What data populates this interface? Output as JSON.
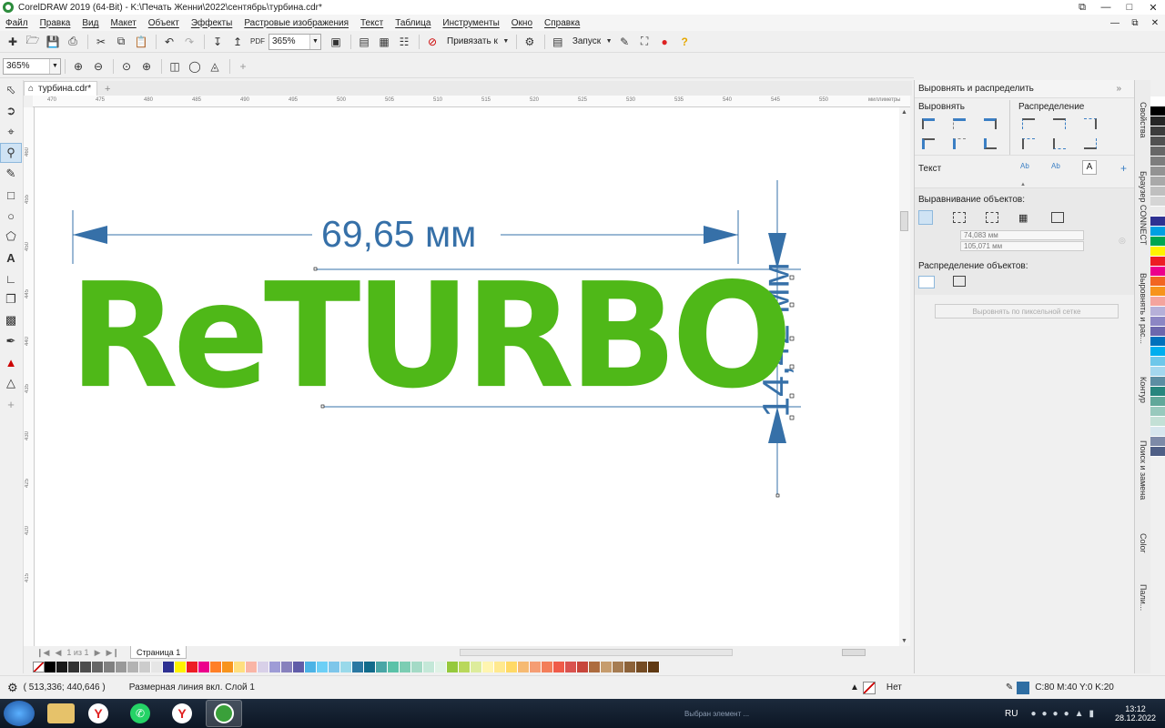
{
  "window": {
    "title": "CorelDRAW 2019 (64-Bit) - K:\\Печать Женни\\2022\\сентябрь\\турбина.cdr*",
    "buttons": [
      "⧉",
      "—",
      "□",
      "✕"
    ]
  },
  "menu": [
    "Файл",
    "Правка",
    "Вид",
    "Макет",
    "Объект",
    "Эффекты",
    "Растровые изображения",
    "Текст",
    "Таблица",
    "Инструменты",
    "Окно",
    "Справка"
  ],
  "toolbar": {
    "zoom_value": "365%",
    "snap_label": "Привязать к",
    "launch_label": "Запуск"
  },
  "propbar": {
    "zoom_value": "365%"
  },
  "document": {
    "tab_label": "турбина.cdr*",
    "ruler_unit": "миллиметры",
    "h_ruler_labels": [
      "470",
      "475",
      "480",
      "485",
      "490",
      "495",
      "500",
      "505",
      "510",
      "515",
      "520",
      "525",
      "530",
      "535",
      "540",
      "545",
      "550"
    ],
    "v_ruler_labels": [
      "460",
      "455",
      "450",
      "445",
      "440",
      "435",
      "430",
      "425",
      "420",
      "415"
    ],
    "page_tab": "Страница 1",
    "page_counter": "1  из  1"
  },
  "artwork": {
    "main_text": "ReTURBO",
    "width_dimension": "69,65 мм",
    "height_dimension": "14,42 мм",
    "text_color": "#4fb818",
    "dim_color": "#3670a8"
  },
  "docker": {
    "title": "Выровнять и распределить",
    "align_label": "Выровнять",
    "distribute_label": "Распределение",
    "text_label": "Текст",
    "align_objects_label": "Выравнивание объектов:",
    "x_value": "74,083 мм",
    "y_value": "105,071 мм",
    "distribute_objects_label": "Распределение объектов:",
    "pixel_grid_button": "Выровнять по пиксельной сетке"
  },
  "side_tabs": [
    "Свойства",
    "Браузер CONNECT",
    "Выровнять и рас...",
    "Контур",
    "Поиск и замена",
    "Color",
    "Пали..."
  ],
  "status": {
    "coordinates": "( 513,336; 440,646 )",
    "selection_info": "Размерная линия вкл. Слой 1",
    "fill_label": "Нет",
    "outline_color": "C:80 M:40 Y:0 K:20"
  },
  "taskbar": {
    "language": "RU",
    "time": "13:12",
    "date": "28.12.2022",
    "notification_text": "Выбран элемент ..."
  },
  "palette_colors": [
    "#000000",
    "#1a1a1a",
    "#333333",
    "#4d4d4d",
    "#666666",
    "#808080",
    "#999999",
    "#b3b3b3",
    "#cccccc",
    "#e6e6e6",
    "#2e3192",
    "#fff200",
    "#ed1c24",
    "#ec008c",
    "#ff7f27",
    "#f7941d",
    "#ffdf7f",
    "#f9b5a6",
    "#d8d0e8",
    "#9e9cd6",
    "#8781bd",
    "#605ca8",
    "#4cb3e6",
    "#6dcff6",
    "#7ec6ea",
    "#99d9ea",
    "#2b78a2",
    "#126b8b",
    "#49a6a6",
    "#5bc2a8",
    "#7ccdb3",
    "#a4dac6",
    "#c4e8d8",
    "#e0f2e6",
    "#95c93d",
    "#b9d85c",
    "#ddec9c",
    "#fff5b0",
    "#ffe98f",
    "#ffd966",
    "#f6ba73",
    "#f59d74",
    "#f37e5a",
    "#ef5b49",
    "#d9534f",
    "#c7463b",
    "#ad6c3f",
    "#c69c6d",
    "#a67c52",
    "#8c6239",
    "#754c24",
    "#603913"
  ],
  "palette_v_colors": [
    "#ffffff",
    "#000000",
    "#262626",
    "#3c3c3c",
    "#515151",
    "#676767",
    "#7d7d7d",
    "#939393",
    "#a9a9a9",
    "#bfbfbf",
    "#d5d5d5",
    "#ebebeb",
    "#2e3192",
    "#00a0e3",
    "#00a651",
    "#fff200",
    "#ed1c24",
    "#ec008c",
    "#f26522",
    "#f7941d",
    "#f4a49e",
    "#b6b0d9",
    "#8c86c4",
    "#6c67ad",
    "#0071bc",
    "#00aeef",
    "#6ec7ea",
    "#a4d7ee",
    "#5c8ea3",
    "#27867e",
    "#61a89a",
    "#98c9bd",
    "#c3e0d6",
    "#d7e6ee",
    "#7d8aa8",
    "#4f5f86"
  ]
}
